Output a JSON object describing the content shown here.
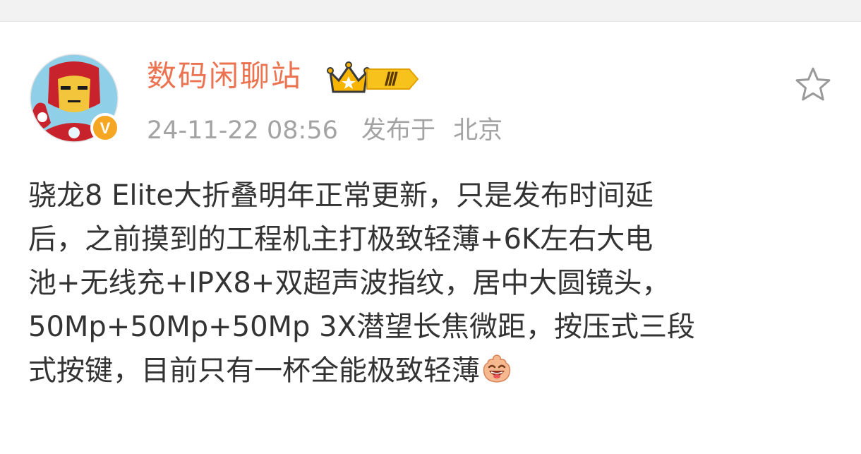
{
  "post": {
    "author": {
      "name": "数码闲聊站",
      "member_level": "Ⅲ",
      "verified_badge_letter": "V",
      "avatar": "iron-man-avatar"
    },
    "timestamp": "24-11-22 08:56",
    "location_label": "发布于",
    "location": "北京",
    "favorite_icon": "star-outline-icon",
    "text_lines": [
      "骁龙8 Elite大折叠明年正常更新，只是发布时间延",
      "后，之前摸到的工程机主打极致轻薄+6K左右大电",
      "池+无线充+IPX8+双超声波指纹，居中大圆镜头，",
      "50Mp+50Mp+50Mp 3X潜望长焦微距，按压式三段",
      "式按键，目前只有一杯全能极致轻薄"
    ],
    "trailing_emoji": "laughing-emoji"
  },
  "colors": {
    "author_name": "#eb7350",
    "meta_text": "#a3a3a3",
    "body_text": "#333333",
    "verified_badge": "#f5a623",
    "badge_gold": "#f7b500"
  }
}
